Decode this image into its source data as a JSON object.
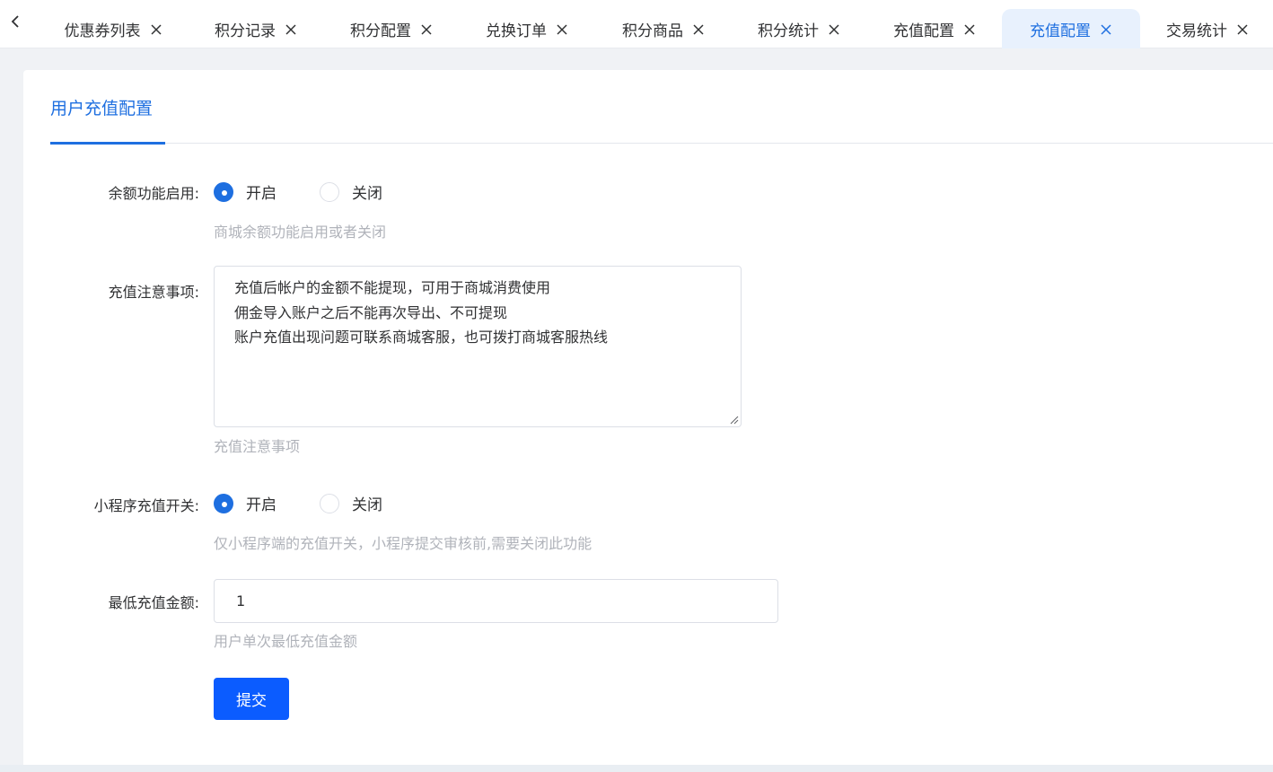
{
  "tabs": [
    {
      "label": "优惠券列表",
      "active": false
    },
    {
      "label": "积分记录",
      "active": false
    },
    {
      "label": "积分配置",
      "active": false
    },
    {
      "label": "兑换订单",
      "active": false
    },
    {
      "label": "积分商品",
      "active": false
    },
    {
      "label": "积分统计",
      "active": false
    },
    {
      "label": "充值配置",
      "active": false
    },
    {
      "label": "充值配置",
      "active": true
    },
    {
      "label": "交易统计",
      "active": false
    }
  ],
  "card_tab": {
    "label": "用户充值配置"
  },
  "form": {
    "balance": {
      "label": "余额功能启用:",
      "on_label": "开启",
      "off_label": "关闭",
      "selected": "开启",
      "help": "商城余额功能启用或者关闭"
    },
    "notes": {
      "label": "充值注意事项:",
      "lines": [
        "充值后帐户的金额不能提现，可用于商城消费使用",
        "佣金导入账户之后不能再次导出、不可提现",
        "账户充值出现问题可联系商城客服，也可拨打商城客服热线"
      ],
      "help": "充值注意事项"
    },
    "miniprogram": {
      "label": "小程序充值开关:",
      "on_label": "开启",
      "off_label": "关闭",
      "selected": "开启",
      "help": "仅小程序端的充值开关，小程序提交审核前,需要关闭此功能"
    },
    "min_amount": {
      "label": "最低充值金额:",
      "value": "1",
      "help": "用户单次最低充值金额"
    },
    "submit_label": "提交"
  },
  "colors": {
    "accent": "#1e6fe0",
    "button": "#0b5cff",
    "help_text": "#b0b3ba"
  }
}
